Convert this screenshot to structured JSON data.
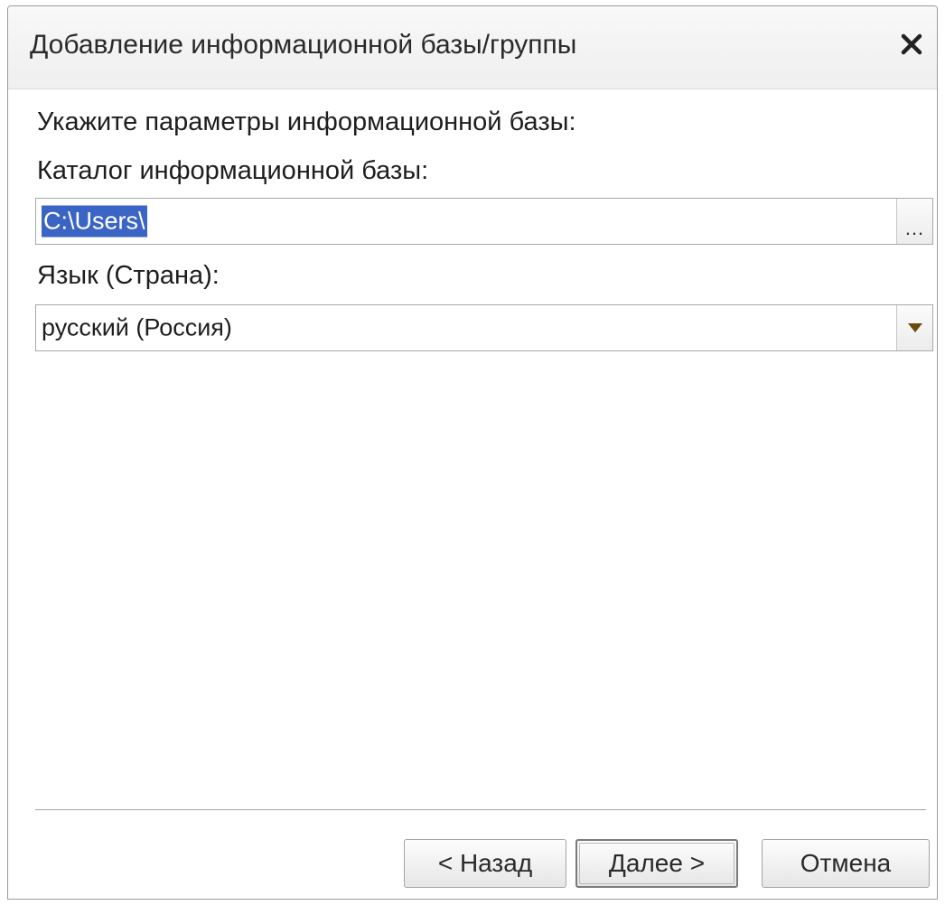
{
  "window": {
    "title": "Добавление информационной базы/группы"
  },
  "form": {
    "heading": "Укажите параметры информационной базы:",
    "catalog_label": "Каталог информационной базы:",
    "catalog_value": "C:\\Users\\",
    "browse_label": "...",
    "language_label": "Язык (Страна):",
    "language_value": "русский (Россия)"
  },
  "buttons": {
    "back": "< Назад",
    "next": "Далее >",
    "cancel": "Отмена"
  },
  "icons": {
    "close": "close-icon",
    "dropdown": "triangle-down-icon"
  },
  "colors": {
    "selection": "#3b65c4",
    "dropdown_arrow": "#6b4a10"
  }
}
